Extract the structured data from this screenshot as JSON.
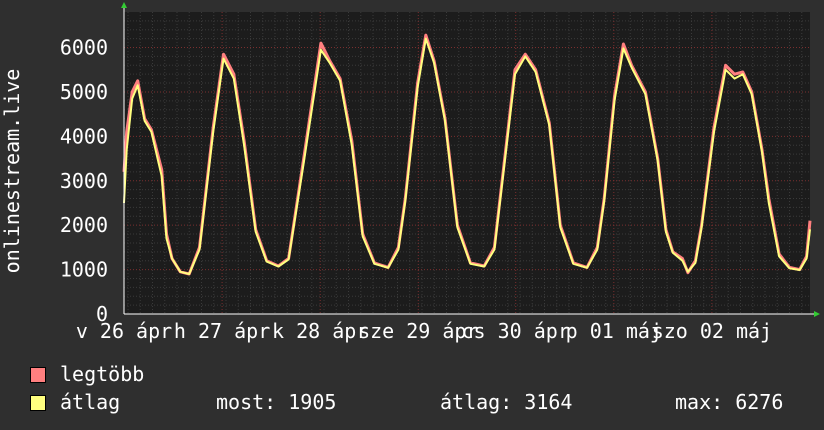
{
  "chart_data": {
    "type": "area",
    "ylabel": "onlinestream.live",
    "ylim": [
      0,
      6800
    ],
    "yticks": [
      0,
      1000,
      2000,
      3000,
      4000,
      5000,
      6000
    ],
    "xlim": [
      0,
      1
    ],
    "x_ticks": [
      {
        "x": 0.0,
        "label": "v 26 ápr"
      },
      {
        "x": 0.143,
        "label": "h 27 ápr"
      },
      {
        "x": 0.286,
        "label": "k 28 ápr"
      },
      {
        "x": 0.429,
        "label": "sze 29 ápr"
      },
      {
        "x": 0.571,
        "label": "cs 30 ápr"
      },
      {
        "x": 0.714,
        "label": "p 01 máj"
      },
      {
        "x": 0.857,
        "label": "szo 02 máj"
      }
    ],
    "grid": true,
    "series": [
      {
        "name": "legtöbb",
        "color": "#ff7f7f",
        "points": [
          [
            0.0,
            3200
          ],
          [
            0.004,
            4100
          ],
          [
            0.012,
            5000
          ],
          [
            0.02,
            5250
          ],
          [
            0.03,
            4400
          ],
          [
            0.04,
            4150
          ],
          [
            0.055,
            3250
          ],
          [
            0.062,
            1800
          ],
          [
            0.07,
            1250
          ],
          [
            0.082,
            950
          ],
          [
            0.095,
            900
          ],
          [
            0.11,
            1500
          ],
          [
            0.13,
            4200
          ],
          [
            0.145,
            5850
          ],
          [
            0.16,
            5400
          ],
          [
            0.175,
            3900
          ],
          [
            0.192,
            1900
          ],
          [
            0.208,
            1200
          ],
          [
            0.225,
            1080
          ],
          [
            0.24,
            1250
          ],
          [
            0.262,
            3500
          ],
          [
            0.287,
            6100
          ],
          [
            0.3,
            5700
          ],
          [
            0.315,
            5300
          ],
          [
            0.332,
            3900
          ],
          [
            0.348,
            1800
          ],
          [
            0.365,
            1150
          ],
          [
            0.385,
            1050
          ],
          [
            0.4,
            1500
          ],
          [
            0.41,
            2600
          ],
          [
            0.428,
            5200
          ],
          [
            0.44,
            6280
          ],
          [
            0.452,
            5700
          ],
          [
            0.468,
            4400
          ],
          [
            0.486,
            2000
          ],
          [
            0.505,
            1150
          ],
          [
            0.525,
            1080
          ],
          [
            0.54,
            1500
          ],
          [
            0.57,
            5500
          ],
          [
            0.585,
            5850
          ],
          [
            0.6,
            5500
          ],
          [
            0.62,
            4300
          ],
          [
            0.636,
            2000
          ],
          [
            0.655,
            1150
          ],
          [
            0.675,
            1050
          ],
          [
            0.69,
            1500
          ],
          [
            0.7,
            2600
          ],
          [
            0.715,
            4900
          ],
          [
            0.728,
            6080
          ],
          [
            0.74,
            5600
          ],
          [
            0.76,
            5000
          ],
          [
            0.778,
            3500
          ],
          [
            0.79,
            1900
          ],
          [
            0.8,
            1400
          ],
          [
            0.814,
            1250
          ],
          [
            0.822,
            930
          ],
          [
            0.833,
            1200
          ],
          [
            0.842,
            2000
          ],
          [
            0.86,
            4200
          ],
          [
            0.877,
            5600
          ],
          [
            0.89,
            5400
          ],
          [
            0.902,
            5450
          ],
          [
            0.915,
            5000
          ],
          [
            0.93,
            3700
          ],
          [
            0.94,
            2600
          ],
          [
            0.955,
            1350
          ],
          [
            0.97,
            1050
          ],
          [
            0.985,
            1000
          ],
          [
            0.995,
            1300
          ],
          [
            1.0,
            2100
          ]
        ]
      },
      {
        "name": "átlag",
        "color": "#ffff7f",
        "points": [
          [
            0.0,
            2500
          ],
          [
            0.004,
            3700
          ],
          [
            0.012,
            4850
          ],
          [
            0.02,
            5150
          ],
          [
            0.03,
            4350
          ],
          [
            0.04,
            4100
          ],
          [
            0.055,
            3100
          ],
          [
            0.062,
            1700
          ],
          [
            0.07,
            1250
          ],
          [
            0.082,
            950
          ],
          [
            0.095,
            900
          ],
          [
            0.11,
            1450
          ],
          [
            0.13,
            4100
          ],
          [
            0.145,
            5750
          ],
          [
            0.16,
            5300
          ],
          [
            0.175,
            3800
          ],
          [
            0.192,
            1850
          ],
          [
            0.208,
            1180
          ],
          [
            0.225,
            1070
          ],
          [
            0.24,
            1230
          ],
          [
            0.262,
            3400
          ],
          [
            0.287,
            5950
          ],
          [
            0.3,
            5650
          ],
          [
            0.315,
            5250
          ],
          [
            0.332,
            3800
          ],
          [
            0.348,
            1750
          ],
          [
            0.365,
            1130
          ],
          [
            0.385,
            1040
          ],
          [
            0.4,
            1450
          ],
          [
            0.41,
            2550
          ],
          [
            0.428,
            5100
          ],
          [
            0.44,
            6200
          ],
          [
            0.452,
            5650
          ],
          [
            0.468,
            4350
          ],
          [
            0.486,
            1950
          ],
          [
            0.505,
            1130
          ],
          [
            0.525,
            1070
          ],
          [
            0.54,
            1450
          ],
          [
            0.57,
            5400
          ],
          [
            0.585,
            5800
          ],
          [
            0.6,
            5450
          ],
          [
            0.62,
            4250
          ],
          [
            0.636,
            1950
          ],
          [
            0.655,
            1130
          ],
          [
            0.675,
            1040
          ],
          [
            0.69,
            1450
          ],
          [
            0.7,
            2550
          ],
          [
            0.715,
            4800
          ],
          [
            0.728,
            5980
          ],
          [
            0.74,
            5550
          ],
          [
            0.76,
            4950
          ],
          [
            0.778,
            3450
          ],
          [
            0.79,
            1850
          ],
          [
            0.8,
            1380
          ],
          [
            0.814,
            1200
          ],
          [
            0.822,
            950
          ],
          [
            0.833,
            1150
          ],
          [
            0.842,
            1950
          ],
          [
            0.86,
            4100
          ],
          [
            0.877,
            5500
          ],
          [
            0.89,
            5300
          ],
          [
            0.902,
            5400
          ],
          [
            0.915,
            4950
          ],
          [
            0.93,
            3650
          ],
          [
            0.94,
            2500
          ],
          [
            0.955,
            1300
          ],
          [
            0.97,
            1030
          ],
          [
            0.985,
            990
          ],
          [
            0.995,
            1250
          ],
          [
            1.0,
            1905
          ]
        ]
      }
    ]
  },
  "legend": {
    "items": [
      {
        "label": "legtöbb",
        "color": "#ff7f7f"
      },
      {
        "label": "átlag",
        "color": "#ffff7f"
      }
    ],
    "stats": {
      "most": "most: 1905",
      "avg": "átlag: 3164",
      "max": "max: 6276"
    }
  }
}
